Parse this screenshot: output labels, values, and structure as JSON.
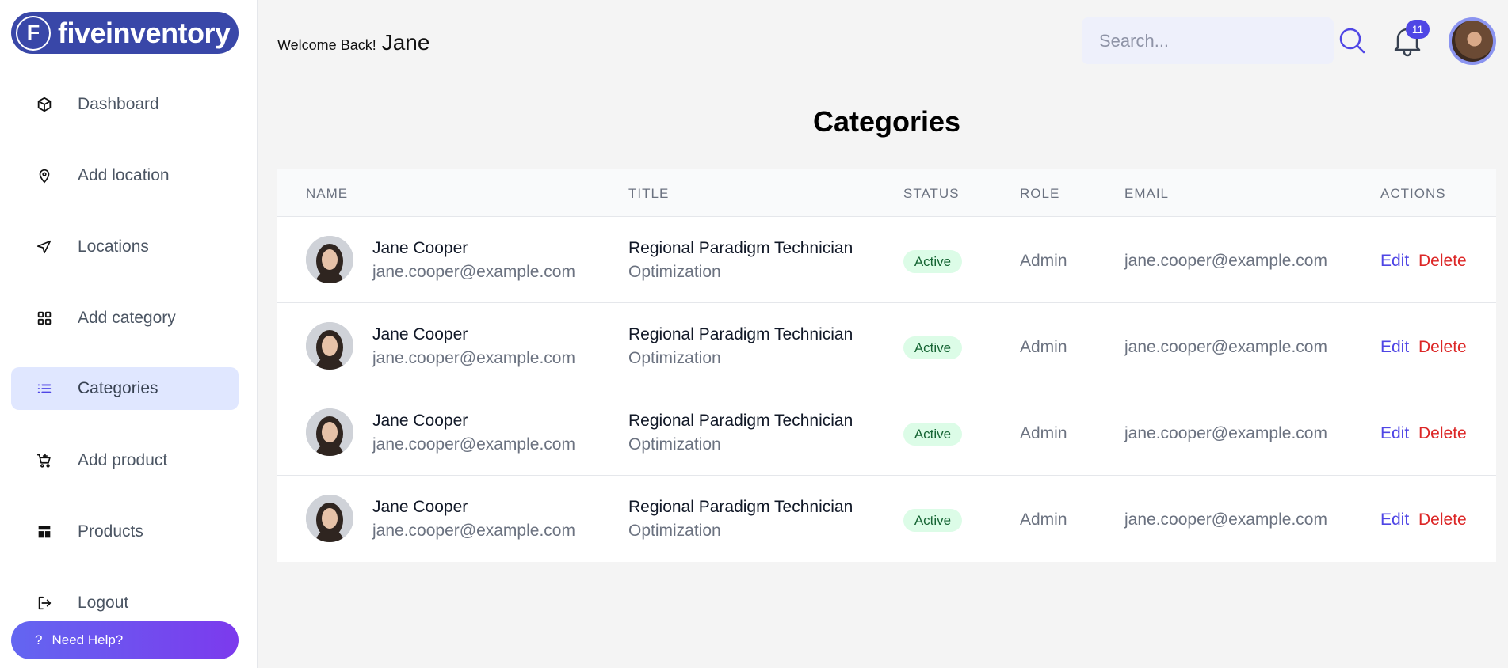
{
  "brand": {
    "logo_letter": "F",
    "name": "fiveinventory"
  },
  "sidebar": {
    "items": [
      {
        "label": "Dashboard",
        "icon": "cube-icon"
      },
      {
        "label": "Add location",
        "icon": "map-pin-icon"
      },
      {
        "label": "Locations",
        "icon": "navigation-arrow-icon"
      },
      {
        "label": "Add category",
        "icon": "grid-plus-icon"
      },
      {
        "label": "Categories",
        "icon": "list-icon",
        "active": true
      },
      {
        "label": "Add product",
        "icon": "cart-plus-icon"
      },
      {
        "label": "Products",
        "icon": "dashboard-layout-icon"
      },
      {
        "label": "Logout",
        "icon": "logout-icon"
      }
    ],
    "help": {
      "icon_text": "?",
      "label": "Need Help?"
    }
  },
  "header": {
    "welcome_text": "Welcome Back!",
    "user_name": "Jane",
    "search_placeholder": "Search...",
    "notification_count": "11"
  },
  "page": {
    "title": "Categories"
  },
  "table": {
    "columns": [
      "NAME",
      "TITLE",
      "STATUS",
      "ROLE",
      "EMAIL",
      "ACTIONS"
    ],
    "rows": [
      {
        "name": "Jane Cooper",
        "name_email": "jane.cooper@example.com",
        "title": "Regional Paradigm Technician",
        "department": "Optimization",
        "status": "Active",
        "role": "Admin",
        "email": "jane.cooper@example.com",
        "edit": "Edit",
        "delete": "Delete"
      },
      {
        "name": "Jane Cooper",
        "name_email": "jane.cooper@example.com",
        "title": "Regional Paradigm Technician",
        "department": "Optimization",
        "status": "Active",
        "role": "Admin",
        "email": "jane.cooper@example.com",
        "edit": "Edit",
        "delete": "Delete"
      },
      {
        "name": "Jane Cooper",
        "name_email": "jane.cooper@example.com",
        "title": "Regional Paradigm Technician",
        "department": "Optimization",
        "status": "Active",
        "role": "Admin",
        "email": "jane.cooper@example.com",
        "edit": "Edit",
        "delete": "Delete"
      },
      {
        "name": "Jane Cooper",
        "name_email": "jane.cooper@example.com",
        "title": "Regional Paradigm Technician",
        "department": "Optimization",
        "status": "Active",
        "role": "Admin",
        "email": "jane.cooper@example.com",
        "edit": "Edit",
        "delete": "Delete"
      }
    ]
  },
  "colors": {
    "brand": "#3947a8",
    "accent": "#4f46e5",
    "active_nav": "#e0e7ff",
    "status_active_bg": "#dcfce7",
    "status_active_text": "#166534",
    "danger": "#dc2626"
  }
}
